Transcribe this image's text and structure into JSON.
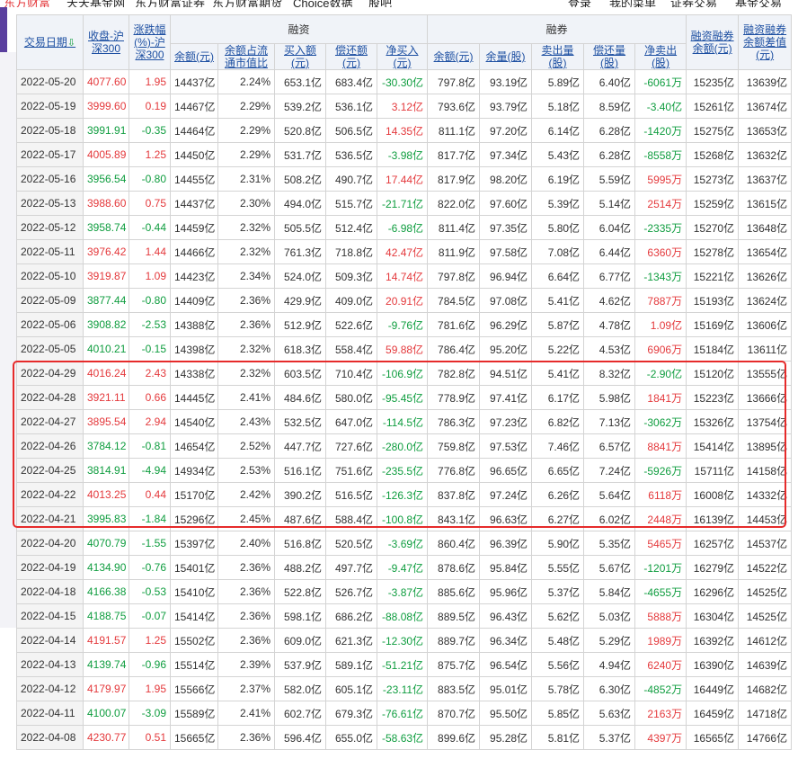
{
  "top_nav": {
    "items": [
      "东方财富",
      "天天基金网",
      "东方财富证券",
      "东方财富期货",
      "Choice数据",
      "股吧",
      "登录",
      "我的菜单",
      "证券交易",
      "基金交易"
    ]
  },
  "table": {
    "headers": {
      "date": "交易日期",
      "close": "收盘-沪深300",
      "change": "涨跌幅(%)-沪深300",
      "financing_group": "融资",
      "securities_group": "融券",
      "margin_balance": "融资融券余额(元)",
      "margin_diff": "融资融券余额差值(元)",
      "fin_balance": "余额(元)",
      "fin_ratio": "余额占流通市值比",
      "fin_buy": "买入额(元)",
      "fin_repay": "偿还额(元)",
      "fin_net": "净买入(元)",
      "sec_balance": "余额(元)",
      "sec_volume": "余量(股)",
      "sec_sell": "卖出量(股)",
      "sec_repay": "偿还量(股)",
      "sec_net": "净卖出(股)"
    },
    "rows": [
      {
        "date": "2022-05-20",
        "close": "4077.60",
        "chg": "1.95",
        "fb": "14437亿",
        "fr": "2.24%",
        "buy": "653.1亿",
        "repay": "683.4亿",
        "net": "-30.30亿",
        "sb": "797.8亿",
        "sv": "93.19亿",
        "ss": "5.89亿",
        "sr": "6.40亿",
        "sn": "-6061万",
        "tot": "15235亿",
        "diff": "13639亿"
      },
      {
        "date": "2022-05-19",
        "close": "3999.60",
        "chg": "0.19",
        "fb": "14467亿",
        "fr": "2.29%",
        "buy": "539.2亿",
        "repay": "536.1亿",
        "net": "3.12亿",
        "sb": "793.6亿",
        "sv": "93.79亿",
        "ss": "5.18亿",
        "sr": "8.59亿",
        "sn": "-3.40亿",
        "tot": "15261亿",
        "diff": "13674亿"
      },
      {
        "date": "2022-05-18",
        "close": "3991.91",
        "chg": "-0.35",
        "fb": "14464亿",
        "fr": "2.29%",
        "buy": "520.8亿",
        "repay": "506.5亿",
        "net": "14.35亿",
        "sb": "811.1亿",
        "sv": "97.20亿",
        "ss": "6.14亿",
        "sr": "6.28亿",
        "sn": "-1420万",
        "tot": "15275亿",
        "diff": "13653亿"
      },
      {
        "date": "2022-05-17",
        "close": "4005.89",
        "chg": "1.25",
        "fb": "14450亿",
        "fr": "2.29%",
        "buy": "531.7亿",
        "repay": "536.5亿",
        "net": "-3.98亿",
        "sb": "817.7亿",
        "sv": "97.34亿",
        "ss": "5.43亿",
        "sr": "6.28亿",
        "sn": "-8558万",
        "tot": "15268亿",
        "diff": "13632亿"
      },
      {
        "date": "2022-05-16",
        "close": "3956.54",
        "chg": "-0.80",
        "fb": "14455亿",
        "fr": "2.31%",
        "buy": "508.2亿",
        "repay": "490.7亿",
        "net": "17.44亿",
        "sb": "817.9亿",
        "sv": "98.20亿",
        "ss": "6.19亿",
        "sr": "5.59亿",
        "sn": "5995万",
        "tot": "15273亿",
        "diff": "13637亿"
      },
      {
        "date": "2022-05-13",
        "close": "3988.60",
        "chg": "0.75",
        "fb": "14437亿",
        "fr": "2.30%",
        "buy": "494.0亿",
        "repay": "515.7亿",
        "net": "-21.71亿",
        "sb": "822.0亿",
        "sv": "97.60亿",
        "ss": "5.39亿",
        "sr": "5.14亿",
        "sn": "2514万",
        "tot": "15259亿",
        "diff": "13615亿"
      },
      {
        "date": "2022-05-12",
        "close": "3958.74",
        "chg": "-0.44",
        "fb": "14459亿",
        "fr": "2.32%",
        "buy": "505.5亿",
        "repay": "512.4亿",
        "net": "-6.98亿",
        "sb": "811.4亿",
        "sv": "97.35亿",
        "ss": "5.80亿",
        "sr": "6.04亿",
        "sn": "-2335万",
        "tot": "15270亿",
        "diff": "13648亿"
      },
      {
        "date": "2022-05-11",
        "close": "3976.42",
        "chg": "1.44",
        "fb": "14466亿",
        "fr": "2.32%",
        "buy": "761.3亿",
        "repay": "718.8亿",
        "net": "42.47亿",
        "sb": "811.9亿",
        "sv": "97.58亿",
        "ss": "7.08亿",
        "sr": "6.44亿",
        "sn": "6360万",
        "tot": "15278亿",
        "diff": "13654亿"
      },
      {
        "date": "2022-05-10",
        "close": "3919.87",
        "chg": "1.09",
        "fb": "14423亿",
        "fr": "2.34%",
        "buy": "524.0亿",
        "repay": "509.3亿",
        "net": "14.74亿",
        "sb": "797.8亿",
        "sv": "96.94亿",
        "ss": "6.64亿",
        "sr": "6.77亿",
        "sn": "-1343万",
        "tot": "15221亿",
        "diff": "13626亿"
      },
      {
        "date": "2022-05-09",
        "close": "3877.44",
        "chg": "-0.80",
        "fb": "14409亿",
        "fr": "2.36%",
        "buy": "429.9亿",
        "repay": "409.0亿",
        "net": "20.91亿",
        "sb": "784.5亿",
        "sv": "97.08亿",
        "ss": "5.41亿",
        "sr": "4.62亿",
        "sn": "7887万",
        "tot": "15193亿",
        "diff": "13624亿"
      },
      {
        "date": "2022-05-06",
        "close": "3908.82",
        "chg": "-2.53",
        "fb": "14388亿",
        "fr": "2.36%",
        "buy": "512.9亿",
        "repay": "522.6亿",
        "net": "-9.76亿",
        "sb": "781.6亿",
        "sv": "96.29亿",
        "ss": "5.87亿",
        "sr": "4.78亿",
        "sn": "1.09亿",
        "tot": "15169亿",
        "diff": "13606亿"
      },
      {
        "date": "2022-05-05",
        "close": "4010.21",
        "chg": "-0.15",
        "fb": "14398亿",
        "fr": "2.32%",
        "buy": "618.3亿",
        "repay": "558.4亿",
        "net": "59.88亿",
        "sb": "786.4亿",
        "sv": "95.20亿",
        "ss": "5.22亿",
        "sr": "4.53亿",
        "sn": "6906万",
        "tot": "15184亿",
        "diff": "13611亿"
      },
      {
        "date": "2022-04-29",
        "close": "4016.24",
        "chg": "2.43",
        "fb": "14338亿",
        "fr": "2.32%",
        "buy": "603.5亿",
        "repay": "710.4亿",
        "net": "-106.9亿",
        "sb": "782.8亿",
        "sv": "94.51亿",
        "ss": "5.41亿",
        "sr": "8.32亿",
        "sn": "-2.90亿",
        "tot": "15120亿",
        "diff": "13555亿"
      },
      {
        "date": "2022-04-28",
        "close": "3921.11",
        "chg": "0.66",
        "fb": "14445亿",
        "fr": "2.41%",
        "buy": "484.6亿",
        "repay": "580.0亿",
        "net": "-95.45亿",
        "sb": "778.9亿",
        "sv": "97.41亿",
        "ss": "6.17亿",
        "sr": "5.98亿",
        "sn": "1841万",
        "tot": "15223亿",
        "diff": "13666亿"
      },
      {
        "date": "2022-04-27",
        "close": "3895.54",
        "chg": "2.94",
        "fb": "14540亿",
        "fr": "2.43%",
        "buy": "532.5亿",
        "repay": "647.0亿",
        "net": "-114.5亿",
        "sb": "786.3亿",
        "sv": "97.23亿",
        "ss": "6.82亿",
        "sr": "7.13亿",
        "sn": "-3062万",
        "tot": "15326亿",
        "diff": "13754亿"
      },
      {
        "date": "2022-04-26",
        "close": "3784.12",
        "chg": "-0.81",
        "fb": "14654亿",
        "fr": "2.52%",
        "buy": "447.7亿",
        "repay": "727.6亿",
        "net": "-280.0亿",
        "sb": "759.8亿",
        "sv": "97.53亿",
        "ss": "7.46亿",
        "sr": "6.57亿",
        "sn": "8841万",
        "tot": "15414亿",
        "diff": "13895亿"
      },
      {
        "date": "2022-04-25",
        "close": "3814.91",
        "chg": "-4.94",
        "fb": "14934亿",
        "fr": "2.53%",
        "buy": "516.1亿",
        "repay": "751.6亿",
        "net": "-235.5亿",
        "sb": "776.8亿",
        "sv": "96.65亿",
        "ss": "6.65亿",
        "sr": "7.24亿",
        "sn": "-5926万",
        "tot": "15711亿",
        "diff": "14158亿"
      },
      {
        "date": "2022-04-22",
        "close": "4013.25",
        "chg": "0.44",
        "fb": "15170亿",
        "fr": "2.42%",
        "buy": "390.2亿",
        "repay": "516.5亿",
        "net": "-126.3亿",
        "sb": "837.8亿",
        "sv": "97.24亿",
        "ss": "6.26亿",
        "sr": "5.64亿",
        "sn": "6118万",
        "tot": "16008亿",
        "diff": "14332亿"
      },
      {
        "date": "2022-04-21",
        "close": "3995.83",
        "chg": "-1.84",
        "fb": "15296亿",
        "fr": "2.45%",
        "buy": "487.6亿",
        "repay": "588.4亿",
        "net": "-100.8亿",
        "sb": "843.1亿",
        "sv": "96.63亿",
        "ss": "6.27亿",
        "sr": "6.02亿",
        "sn": "2448万",
        "tot": "16139亿",
        "diff": "14453亿"
      },
      {
        "date": "2022-04-20",
        "close": "4070.79",
        "chg": "-1.55",
        "fb": "15397亿",
        "fr": "2.40%",
        "buy": "516.8亿",
        "repay": "520.5亿",
        "net": "-3.69亿",
        "sb": "860.4亿",
        "sv": "96.39亿",
        "ss": "5.90亿",
        "sr": "5.35亿",
        "sn": "5465万",
        "tot": "16257亿",
        "diff": "14537亿"
      },
      {
        "date": "2022-04-19",
        "close": "4134.90",
        "chg": "-0.76",
        "fb": "15401亿",
        "fr": "2.36%",
        "buy": "488.2亿",
        "repay": "497.7亿",
        "net": "-9.47亿",
        "sb": "878.6亿",
        "sv": "95.84亿",
        "ss": "5.55亿",
        "sr": "5.67亿",
        "sn": "-1201万",
        "tot": "16279亿",
        "diff": "14522亿"
      },
      {
        "date": "2022-04-18",
        "close": "4166.38",
        "chg": "-0.53",
        "fb": "15410亿",
        "fr": "2.36%",
        "buy": "522.8亿",
        "repay": "526.7亿",
        "net": "-3.87亿",
        "sb": "885.6亿",
        "sv": "95.96亿",
        "ss": "5.37亿",
        "sr": "5.84亿",
        "sn": "-4655万",
        "tot": "16296亿",
        "diff": "14525亿"
      },
      {
        "date": "2022-04-15",
        "close": "4188.75",
        "chg": "-0.07",
        "fb": "15414亿",
        "fr": "2.36%",
        "buy": "598.1亿",
        "repay": "686.2亿",
        "net": "-88.08亿",
        "sb": "889.5亿",
        "sv": "96.43亿",
        "ss": "5.62亿",
        "sr": "5.03亿",
        "sn": "5888万",
        "tot": "16304亿",
        "diff": "14525亿"
      },
      {
        "date": "2022-04-14",
        "close": "4191.57",
        "chg": "1.25",
        "fb": "15502亿",
        "fr": "2.36%",
        "buy": "609.0亿",
        "repay": "621.3亿",
        "net": "-12.30亿",
        "sb": "889.7亿",
        "sv": "96.34亿",
        "ss": "5.48亿",
        "sr": "5.29亿",
        "sn": "1989万",
        "tot": "16392亿",
        "diff": "14612亿"
      },
      {
        "date": "2022-04-13",
        "close": "4139.74",
        "chg": "-0.96",
        "fb": "15514亿",
        "fr": "2.39%",
        "buy": "537.9亿",
        "repay": "589.1亿",
        "net": "-51.21亿",
        "sb": "875.7亿",
        "sv": "96.54亿",
        "ss": "5.56亿",
        "sr": "4.94亿",
        "sn": "6240万",
        "tot": "16390亿",
        "diff": "14639亿"
      },
      {
        "date": "2022-04-12",
        "close": "4179.97",
        "chg": "1.95",
        "fb": "15566亿",
        "fr": "2.37%",
        "buy": "582.0亿",
        "repay": "605.1亿",
        "net": "-23.11亿",
        "sb": "883.5亿",
        "sv": "95.01亿",
        "ss": "5.78亿",
        "sr": "6.30亿",
        "sn": "-4852万",
        "tot": "16449亿",
        "diff": "14682亿"
      },
      {
        "date": "2022-04-11",
        "close": "4100.07",
        "chg": "-3.09",
        "fb": "15589亿",
        "fr": "2.41%",
        "buy": "602.7亿",
        "repay": "679.3亿",
        "net": "-76.61亿",
        "sb": "870.7亿",
        "sv": "95.50亿",
        "ss": "5.85亿",
        "sr": "5.63亿",
        "sn": "2163万",
        "tot": "16459亿",
        "diff": "14718亿"
      },
      {
        "date": "2022-04-08",
        "close": "4230.77",
        "chg": "0.51",
        "fb": "15665亿",
        "fr": "2.36%",
        "buy": "596.4亿",
        "repay": "655.0亿",
        "net": "-58.63亿",
        "sb": "899.6亿",
        "sv": "95.28亿",
        "ss": "5.81亿",
        "sr": "5.37亿",
        "sn": "4397万",
        "tot": "16565亿",
        "diff": "14766亿"
      }
    ]
  },
  "colors": {
    "up": "#e4393c",
    "down": "#0f9d3f",
    "header_bg": "#f0f3f8",
    "highlight_border": "#e62b2b"
  },
  "icons": {
    "sort": "sort-down-arrow-icon"
  }
}
